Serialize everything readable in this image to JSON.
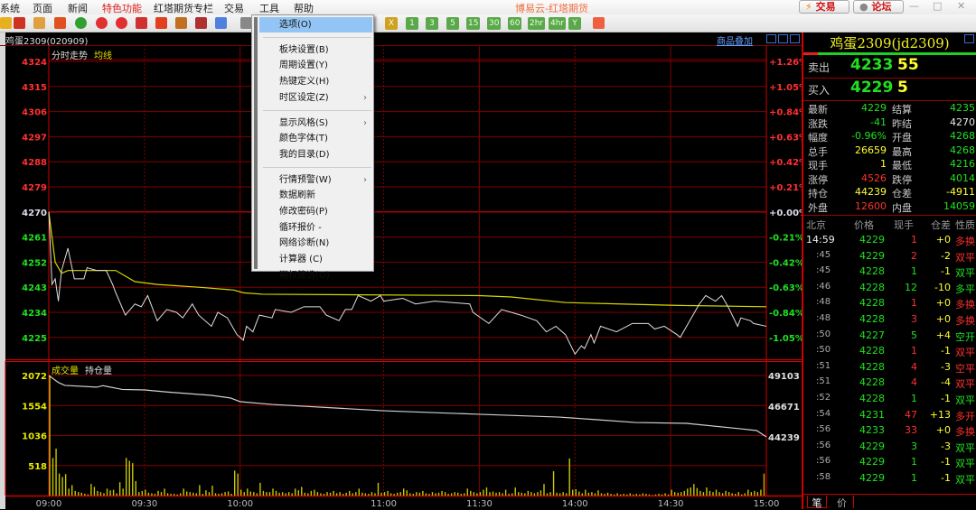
{
  "menubar": {
    "items": [
      "系统",
      "页面",
      "新闻",
      "特色功能",
      "红塔期货专栏",
      "交易",
      "工具",
      "帮助"
    ],
    "active_index": 3
  },
  "window": {
    "title": "博易云-红塔期货",
    "trade_button": "交易",
    "forum_button": "论坛"
  },
  "toolbar": {
    "icons": [
      "arrow-icon",
      "home-icon",
      "notes-icon",
      "f10-icon",
      "refresh-icon",
      "zoom-in-icon",
      "zoom-out-icon",
      "window-icon",
      "draw-icon",
      "alarm-icon",
      "filter-icon",
      "news-icon",
      "list-icon"
    ],
    "period_buttons": [
      "X",
      "1",
      "3",
      "5",
      "15",
      "30",
      "60",
      "2hr",
      "4hr",
      "Y"
    ]
  },
  "chart": {
    "instrument": "鸡蛋2309(020909)",
    "overlay_link": "商品叠加",
    "price_legend": [
      "分时走势",
      "均线"
    ],
    "volume_legend": [
      "成交量",
      "持仓量"
    ]
  },
  "context_menu": {
    "items": [
      {
        "label": "选项(O)",
        "highlighted": true
      },
      {
        "sep": true
      },
      {
        "label": "板块设置(B)"
      },
      {
        "label": "周期设置(Y)"
      },
      {
        "label": "热键定义(H)"
      },
      {
        "label": "时区设定(Z)",
        "submenu": true
      },
      {
        "sep": true
      },
      {
        "label": "显示风格(S)",
        "submenu": true
      },
      {
        "label": "颜色字体(T)"
      },
      {
        "label": "我的目录(D)"
      },
      {
        "sep": true
      },
      {
        "label": "行情预警(W)",
        "submenu": true
      },
      {
        "label": "数据刷新"
      },
      {
        "label": "修改密码(P)"
      },
      {
        "label": "循环报价      -"
      },
      {
        "label": "网络诊断(N)"
      },
      {
        "label": "计算器  (C)"
      },
      {
        "label": "期权筛选(O)"
      }
    ]
  },
  "quote": {
    "title": "鸡蛋2309(jd2309)",
    "ask": {
      "label": "卖出",
      "price": "4233",
      "volume": "55"
    },
    "bid": {
      "label": "买入",
      "price": "4229",
      "volume": "5"
    },
    "stats": [
      {
        "l": "最新",
        "v": "4229",
        "c": "g",
        "l2": "结算",
        "v2": "4235",
        "c2": "g"
      },
      {
        "l": "涨跌",
        "v": "-41",
        "c": "g",
        "l2": "昨结",
        "v2": "4270",
        "c2": "w"
      },
      {
        "l": "幅度",
        "v": "-0.96%",
        "c": "g",
        "l2": "开盘",
        "v2": "4268",
        "c2": "g"
      },
      {
        "l": "总手",
        "v": "26659",
        "c": "y",
        "l2": "最高",
        "v2": "4268",
        "c2": "g"
      },
      {
        "l": "现手",
        "v": "1",
        "c": "y",
        "l2": "最低",
        "v2": "4216",
        "c2": "g"
      },
      {
        "l": "涨停",
        "v": "4526",
        "c": "r",
        "l2": "跌停",
        "v2": "4014",
        "c2": "g"
      },
      {
        "l": "持仓",
        "v": "44239",
        "c": "y",
        "l2": "仓差",
        "v2": "-4911",
        "c2": "y"
      },
      {
        "l": "外盘",
        "v": "12600",
        "c": "r",
        "l2": "内盘",
        "v2": "14059",
        "c2": "g"
      }
    ],
    "ticks_header": [
      "北京",
      "价格",
      "现手",
      "仓差",
      "性质"
    ],
    "ticks": [
      {
        "t": "14:59",
        "p": "4229",
        "v": "1",
        "oi": "+0",
        "type": "多换",
        "c": "r"
      },
      {
        "t": ":45",
        "p": "4229",
        "v": "2",
        "oi": "-2",
        "type": "双平",
        "c": "r"
      },
      {
        "t": ":45",
        "p": "4228",
        "v": "1",
        "oi": "-1",
        "type": "双平",
        "c": "g"
      },
      {
        "t": ":46",
        "p": "4228",
        "v": "12",
        "oi": "-10",
        "type": "多平",
        "c": "g"
      },
      {
        "t": ":48",
        "p": "4228",
        "v": "1",
        "oi": "+0",
        "type": "多换",
        "c": "r"
      },
      {
        "t": ":48",
        "p": "4228",
        "v": "3",
        "oi": "+0",
        "type": "多换",
        "c": "r"
      },
      {
        "t": ":50",
        "p": "4227",
        "v": "5",
        "oi": "+4",
        "type": "空开",
        "c": "g"
      },
      {
        "t": ":50",
        "p": "4228",
        "v": "1",
        "oi": "-1",
        "type": "双平",
        "c": "r"
      },
      {
        "t": ":51",
        "p": "4228",
        "v": "4",
        "oi": "-3",
        "type": "空平",
        "c": "r"
      },
      {
        "t": ":51",
        "p": "4228",
        "v": "4",
        "oi": "-4",
        "type": "双平",
        "c": "r"
      },
      {
        "t": ":52",
        "p": "4228",
        "v": "1",
        "oi": "-1",
        "type": "双平",
        "c": "g"
      },
      {
        "t": ":54",
        "p": "4231",
        "v": "47",
        "oi": "+13",
        "type": "多开",
        "c": "r"
      },
      {
        "t": ":56",
        "p": "4233",
        "v": "33",
        "oi": "+0",
        "type": "多换",
        "c": "r"
      },
      {
        "t": ":56",
        "p": "4229",
        "v": "3",
        "oi": "-3",
        "type": "双平",
        "c": "g"
      },
      {
        "t": ":56",
        "p": "4229",
        "v": "1",
        "oi": "-1",
        "type": "双平",
        "c": "g"
      },
      {
        "t": ":58",
        "p": "4229",
        "v": "1",
        "oi": "-1",
        "type": "双平",
        "c": "g"
      }
    ],
    "tabs": [
      "笔",
      "价"
    ]
  },
  "colors": {
    "up": "#ff3030",
    "down": "#20e020",
    "grid": "#800000",
    "axis": "#d00000",
    "price_line": "#e0e0e0",
    "avg_line": "#d8d800",
    "volume": "#c8c800",
    "oi_line": "#d0d0d0"
  },
  "chart_data": [
    {
      "type": "line",
      "title": "分时走势",
      "prev_settle": 4270,
      "ylim": [
        4217,
        4324
      ],
      "y_ticks": [
        4324,
        4315,
        4306,
        4297,
        4288,
        4279,
        4270,
        4261,
        4252,
        4243,
        4234,
        4225
      ],
      "pct_ticks": [
        "+1.26%",
        "+1.05%",
        "+0.84%",
        "+0.63%",
        "+0.42%",
        "+0.21%",
        "+0.00%",
        "-0.21%",
        "-0.42%",
        "-0.63%",
        "-0.84%",
        "-1.05%"
      ],
      "x_ticks": [
        {
          "t": "09:00"
        },
        {
          "t": "09:30",
          "dashed": true
        },
        {
          "t": "10:00"
        },
        {
          "t": "11:00",
          "dashed": true
        },
        {
          "t": "11:30"
        },
        {
          "t": "14:00",
          "dashed": true
        },
        {
          "t": "14:30"
        },
        {
          "t": "15:00"
        }
      ],
      "sessions": [
        [
          "09:00",
          "10:15"
        ],
        [
          "10:30",
          "11:30"
        ],
        [
          "13:30",
          "15:00"
        ]
      ],
      "series": [
        {
          "name": "分时走势",
          "x": [
            "09:00",
            "09:01",
            "09:02",
            "09:03",
            "09:04",
            "09:06",
            "09:08",
            "09:11",
            "09:12",
            "09:15",
            "09:18",
            "09:20",
            "09:21",
            "09:24",
            "09:27",
            "09:29",
            "09:31",
            "09:34",
            "09:37",
            "09:40",
            "09:42",
            "09:45",
            "09:47",
            "09:51",
            "09:53",
            "09:56",
            "09:59",
            "10:01",
            "10:02",
            "10:04",
            "10:06",
            "10:10",
            "10:11",
            "10:31",
            "10:35",
            "10:40",
            "10:42",
            "10:46",
            "10:48",
            "10:50",
            "10:52",
            "10:56",
            "10:59",
            "11:00",
            "11:06",
            "11:10",
            "11:16",
            "11:27",
            "11:28",
            "13:33",
            "13:37",
            "13:40",
            "13:43",
            "13:48",
            "13:51",
            "13:54",
            "13:57",
            "14:00",
            "14:02",
            "14:03",
            "14:05",
            "14:06",
            "14:08",
            "14:13",
            "14:18",
            "14:23",
            "14:25",
            "14:28",
            "14:32",
            "14:33",
            "14:36",
            "14:39",
            "14:41",
            "14:44",
            "14:46",
            "14:48",
            "14:51",
            "14:52",
            "14:55",
            "14:56",
            "15:00"
          ],
          "y": [
            4270,
            4244,
            4246,
            4238,
            4249,
            4257,
            4246,
            4246,
            4250,
            4249,
            4249,
            4244,
            4241,
            4233,
            4237,
            4236,
            4240,
            4231,
            4235,
            4234,
            4232,
            4237,
            4233,
            4229,
            4234,
            4232,
            4226,
            4224,
            4229,
            4227,
            4233,
            4232,
            4235,
            4234,
            4236,
            4236,
            4233,
            4231,
            4235,
            4235,
            4240,
            4238,
            4240,
            4238,
            4239,
            4237,
            4238,
            4237,
            4234,
            4230,
            4235,
            4234,
            4233,
            4231,
            4227,
            4229,
            4226,
            4219,
            4222,
            4221,
            4226,
            4223,
            4229,
            4227,
            4230,
            4230,
            4228,
            4229,
            4226,
            4225,
            4231,
            4237,
            4240,
            4238,
            4240,
            4236,
            4229,
            4232,
            4231,
            4230,
            4229
          ]
        },
        {
          "name": "均线",
          "x": [
            "09:00",
            "09:02",
            "09:04",
            "09:06",
            "09:21",
            "09:27",
            "09:34",
            "09:47",
            "09:58",
            "10:01",
            "10:07",
            "11:30",
            "13:40",
            "13:57",
            "14:14",
            "14:31",
            "15:00"
          ],
          "y": [
            4270,
            4252,
            4248,
            4249,
            4249,
            4245,
            4244,
            4243,
            4242,
            4241,
            4240.5,
            4240,
            4239.5,
            4237.5,
            4237,
            4236.5,
            4236
          ]
        }
      ]
    },
    {
      "type": "bar",
      "title": "成交量",
      "ylim": [
        0,
        2072
      ],
      "y_ticks": [
        2072,
        1554,
        1036,
        518
      ],
      "start": "09:00",
      "interval_minutes": 1,
      "values": [
        2072,
        650,
        810,
        380,
        320,
        370,
        120,
        180,
        80,
        60,
        50,
        30,
        20,
        200,
        150,
        80,
        60,
        40,
        120,
        90,
        100,
        40,
        230,
        120,
        650,
        600,
        560,
        250,
        60,
        80,
        100,
        50,
        40,
        30,
        80,
        60,
        120,
        40,
        30,
        30,
        20,
        40,
        120,
        70,
        60,
        50,
        40,
        180,
        30,
        90,
        60,
        170,
        40,
        30,
        40,
        60,
        70,
        30,
        430,
        380,
        100,
        60,
        120,
        70,
        60,
        40,
        220,
        80,
        60,
        60,
        120,
        80,
        50,
        60,
        40,
        60,
        40,
        120,
        90,
        150,
        50,
        40,
        80,
        100,
        60,
        40,
        30,
        60,
        50,
        80,
        40,
        60,
        30,
        50,
        80,
        40,
        60,
        120,
        50,
        40,
        30,
        60,
        40,
        220,
        50,
        60,
        80,
        40,
        30,
        50,
        60,
        120,
        90,
        40,
        30,
        60,
        50,
        80,
        40,
        30,
        60,
        40,
        50,
        80,
        60,
        30,
        40,
        60,
        50,
        30,
        40,
        120,
        80,
        60,
        40,
        60,
        100,
        140,
        60,
        70,
        50,
        60,
        40,
        100,
        30,
        40,
        140,
        60,
        50,
        40,
        80,
        60,
        40,
        60,
        90,
        200,
        40,
        60,
        420,
        50,
        40,
        60,
        40,
        640,
        100,
        110,
        70,
        40,
        100,
        50,
        60,
        40,
        90,
        40,
        30,
        50,
        30,
        20,
        40,
        20,
        30,
        20,
        40,
        20,
        30,
        20,
        40,
        30,
        20,
        10,
        20,
        30,
        20,
        40,
        20,
        100,
        60,
        50,
        60,
        80,
        120,
        140,
        200,
        130,
        80,
        60,
        140,
        80,
        60,
        100,
        60,
        40,
        80,
        60,
        40,
        30,
        60,
        20,
        40,
        100,
        60,
        80,
        60,
        100,
        380
      ]
    },
    {
      "type": "line",
      "title": "持仓量",
      "ylim": [
        42000,
        49103
      ],
      "y_ticks": [
        49103,
        46671,
        44239
      ],
      "x": [
        "09:00",
        "09:03",
        "09:05",
        "09:15",
        "09:17",
        "09:23",
        "09:30",
        "09:37",
        "09:51",
        "09:57",
        "10:00",
        "10:10",
        "11:00",
        "13:30",
        "13:55",
        "14:07",
        "14:19",
        "14:35",
        "14:52",
        "14:57",
        "15:00"
      ],
      "y": [
        49103,
        48550,
        48320,
        48180,
        48300,
        48000,
        47960,
        47800,
        47530,
        47320,
        47030,
        46810,
        46310,
        46030,
        45810,
        45600,
        45380,
        45310,
        44880,
        44740,
        44239
      ]
    }
  ]
}
